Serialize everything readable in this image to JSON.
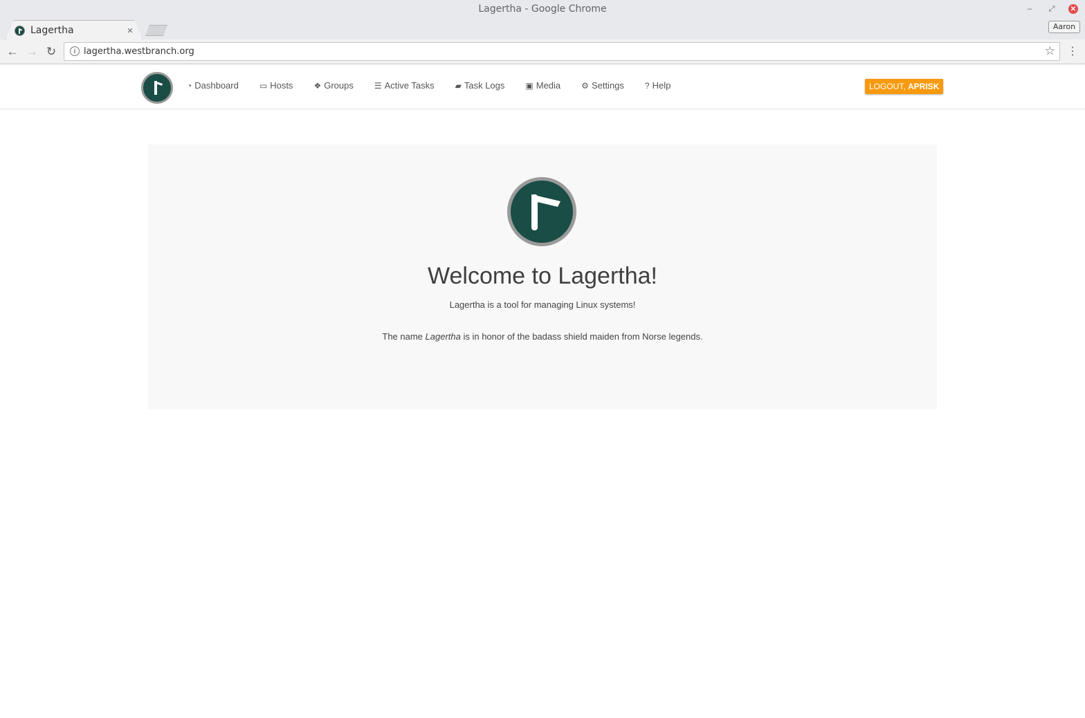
{
  "window": {
    "title": "Lagertha - Google Chrome",
    "profile": "Aaron"
  },
  "tabs": [
    {
      "title": "Lagertha",
      "close": "×"
    }
  ],
  "toolbar": {
    "url": "lagertha.westbranch.org"
  },
  "navbar": {
    "items": [
      {
        "label": "Dashboard",
        "icon": "dashboard-icon",
        "glyph": "◔"
      },
      {
        "label": "Hosts",
        "icon": "desktop-icon",
        "glyph": "▭"
      },
      {
        "label": "Groups",
        "icon": "cubes-icon",
        "glyph": "❖"
      },
      {
        "label": "Active Tasks",
        "icon": "tasks-icon",
        "glyph": "☰"
      },
      {
        "label": "Task Logs",
        "icon": "book-icon",
        "glyph": "▰"
      },
      {
        "label": "Media",
        "icon": "image-icon",
        "glyph": "▣"
      },
      {
        "label": "Settings",
        "icon": "gear-icon",
        "glyph": "⚙"
      },
      {
        "label": "Help",
        "icon": "question-icon",
        "glyph": "?"
      }
    ],
    "logout_prefix": "LOGOUT, ",
    "logout_user": "APRISK"
  },
  "colors": {
    "brand_green": "#1a4d45",
    "logout_orange": "#f79a0f"
  },
  "main": {
    "title": "Welcome to Lagertha!",
    "subtitle": "Lagertha is a tool for managing Linux systems!",
    "note_before": "The name ",
    "note_name": "Lagertha",
    "note_after": " is in honor of the badass shield maiden from Norse legends."
  }
}
